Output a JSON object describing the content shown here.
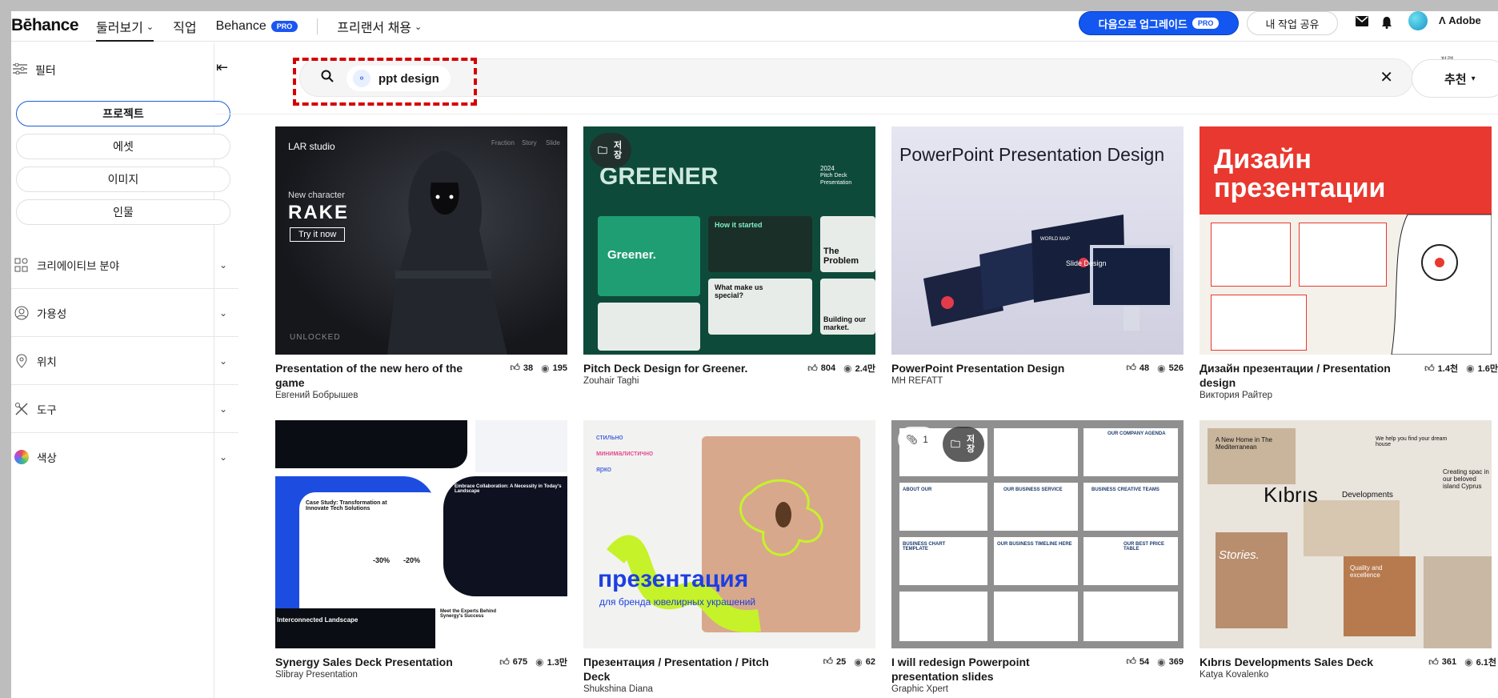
{
  "header": {
    "logo": "Bēhance",
    "nav": [
      {
        "label": "둘러보기",
        "chevron": true
      },
      {
        "label": "직업",
        "chevron": false
      },
      {
        "label": "Behance",
        "chevron": false,
        "badge": "PRO"
      },
      {
        "label": "프리랜서 채용",
        "chevron": true
      }
    ],
    "upgrade_label": "다음으로 업그레이드",
    "upgrade_badge": "PRO",
    "share_label": "내 작업 공유",
    "adobe_label": "Adobe"
  },
  "sidebar": {
    "filter_label": "필터",
    "pills": [
      "프로젝트",
      "에셋",
      "이미지",
      "인물"
    ],
    "sections": [
      "크리에이티브 분야",
      "가용성",
      "위치",
      "도구",
      "색상"
    ]
  },
  "search": {
    "query": "ppt design",
    "sort_caption": "정렬",
    "sort_value": "추천"
  },
  "projects": [
    {
      "title": "Presentation of the new hero of the game",
      "author": "Евгений Бобрышев",
      "likes": "38",
      "views": "195",
      "thumb_texts": [
        "LAR studio",
        "New character",
        "RAKE",
        "Try it now",
        "UNLOCKED",
        "Fraction",
        "Story",
        "Slide"
      ]
    },
    {
      "title": "Pitch Deck Design for Greener.",
      "author": "Zouhair Taghi",
      "likes": "804",
      "views": "2.4만",
      "save": "저장",
      "thumb_texts": [
        "GREENER",
        "2024",
        "Pitch Deck",
        "Presentation",
        "Greener.",
        "How it started",
        "The Problem",
        "What make us special?",
        "Building our market."
      ]
    },
    {
      "title": "PowerPoint Presentation Design",
      "author": "MH REFATT",
      "likes": "48",
      "views": "526",
      "thumb_texts": [
        "PowerPoint Presentation Design",
        "Slide Design",
        "WORLD MAP"
      ]
    },
    {
      "title": "Дизайн презентации / Presentation design",
      "author": "Виктория Райтер",
      "likes": "1.4천",
      "views": "1.6만",
      "thumb_texts": [
        "Дизайн",
        "презентации"
      ]
    },
    {
      "title": "Synergy Sales Deck Presentation",
      "author": "Slibray Presentation",
      "likes": "675",
      "views": "1.3만",
      "thumb_texts": [
        "Case Study: Transformation at Innovate Tech Solutions",
        "Embrace Collaboration: A Necessity in Today's Landscape",
        "Interconnected Landscape",
        "-30%",
        "-20%",
        "Meet the Experts Behind Synergy's Success"
      ]
    },
    {
      "title": "Презентация / Presentation / Pitch Deck",
      "author": "Shukshina Diana",
      "likes": "25",
      "views": "62",
      "thumb_texts": [
        "стильно",
        "минималистично",
        "ярко",
        "презентация",
        "для бренда ювелирных украшений"
      ]
    },
    {
      "title": "I will redesign Powerpoint presentation slides",
      "author": "Graphic Xpert",
      "likes": "54",
      "views": "369",
      "attachments": "1",
      "save": "저장",
      "thumb_texts": [
        "OUR COMPANY AGENDA",
        "OUR BUSINESS SERVICE",
        "BUSINESS CREATIVE TEAMS",
        "ABOUT OUR",
        "BUSINESS CHART TEMPLATE",
        "OUR BUSINESS TIMELINE HERE",
        "OUR BEST PRICE TABLE"
      ]
    },
    {
      "title": "Kıbrıs Developments Sales Deck",
      "author": "Katya Kovalenko",
      "likes": "361",
      "views": "6.1천",
      "thumb_texts": [
        "Kıbrıs",
        "Developments",
        "A New Home in The Mediterranean",
        "We help you find your dream house",
        "Stories.",
        "Quality and excellence",
        "Creating spac in our beloved island Cyprus"
      ]
    }
  ],
  "colors": {
    "accent": "#1357f0",
    "highlight": "#d50000"
  }
}
